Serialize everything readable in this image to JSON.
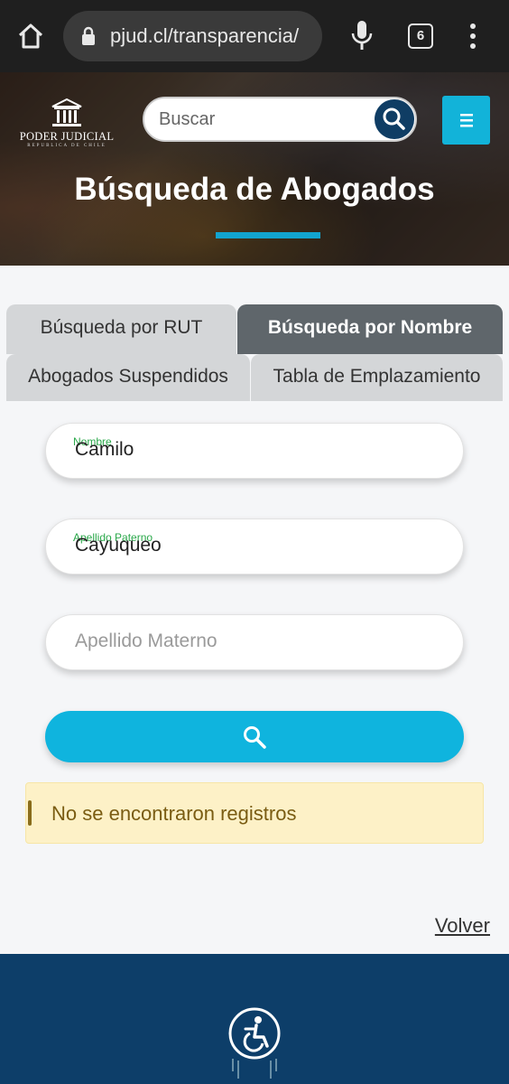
{
  "browser": {
    "url": "pjud.cl/transparencia/",
    "tab_count": "6",
    "icons": [
      "home-icon",
      "lock-icon",
      "mic-icon",
      "tabs-icon",
      "more-vert-icon"
    ]
  },
  "header": {
    "logo_text": "PODER JUDICIAL",
    "logo_subtext": "REPUBLICA DE CHILE",
    "search_placeholder": "Buscar",
    "page_title": "Búsqueda de Abogados",
    "colors": {
      "search_button": "#0f3d64",
      "menu_button": "#12b3d9",
      "underline": "#12a4cf"
    }
  },
  "tabs": [
    {
      "label": "Búsqueda por RUT",
      "active": false
    },
    {
      "label": "Búsqueda por Nombre",
      "active": true
    },
    {
      "label": "Abogados Suspendidos",
      "active": false
    },
    {
      "label": "Tabla de Emplazamiento",
      "active": false
    }
  ],
  "form": {
    "nombre": {
      "label": "Nombre",
      "value": "Camilo"
    },
    "apellido_paterno": {
      "label": "Apellido Paterno",
      "value": "Cayuqueo"
    },
    "apellido_materno": {
      "placeholder": "Apellido Materno",
      "value": ""
    },
    "submit_icon": "search-icon",
    "submit_color": "#0fb4de"
  },
  "alert": {
    "text": "No se encontraron registros",
    "background": "#fdf1c7"
  },
  "links": {
    "volver": "Volver"
  },
  "footer": {
    "icon": "accessibility-icon",
    "background": "#0d3e69"
  }
}
